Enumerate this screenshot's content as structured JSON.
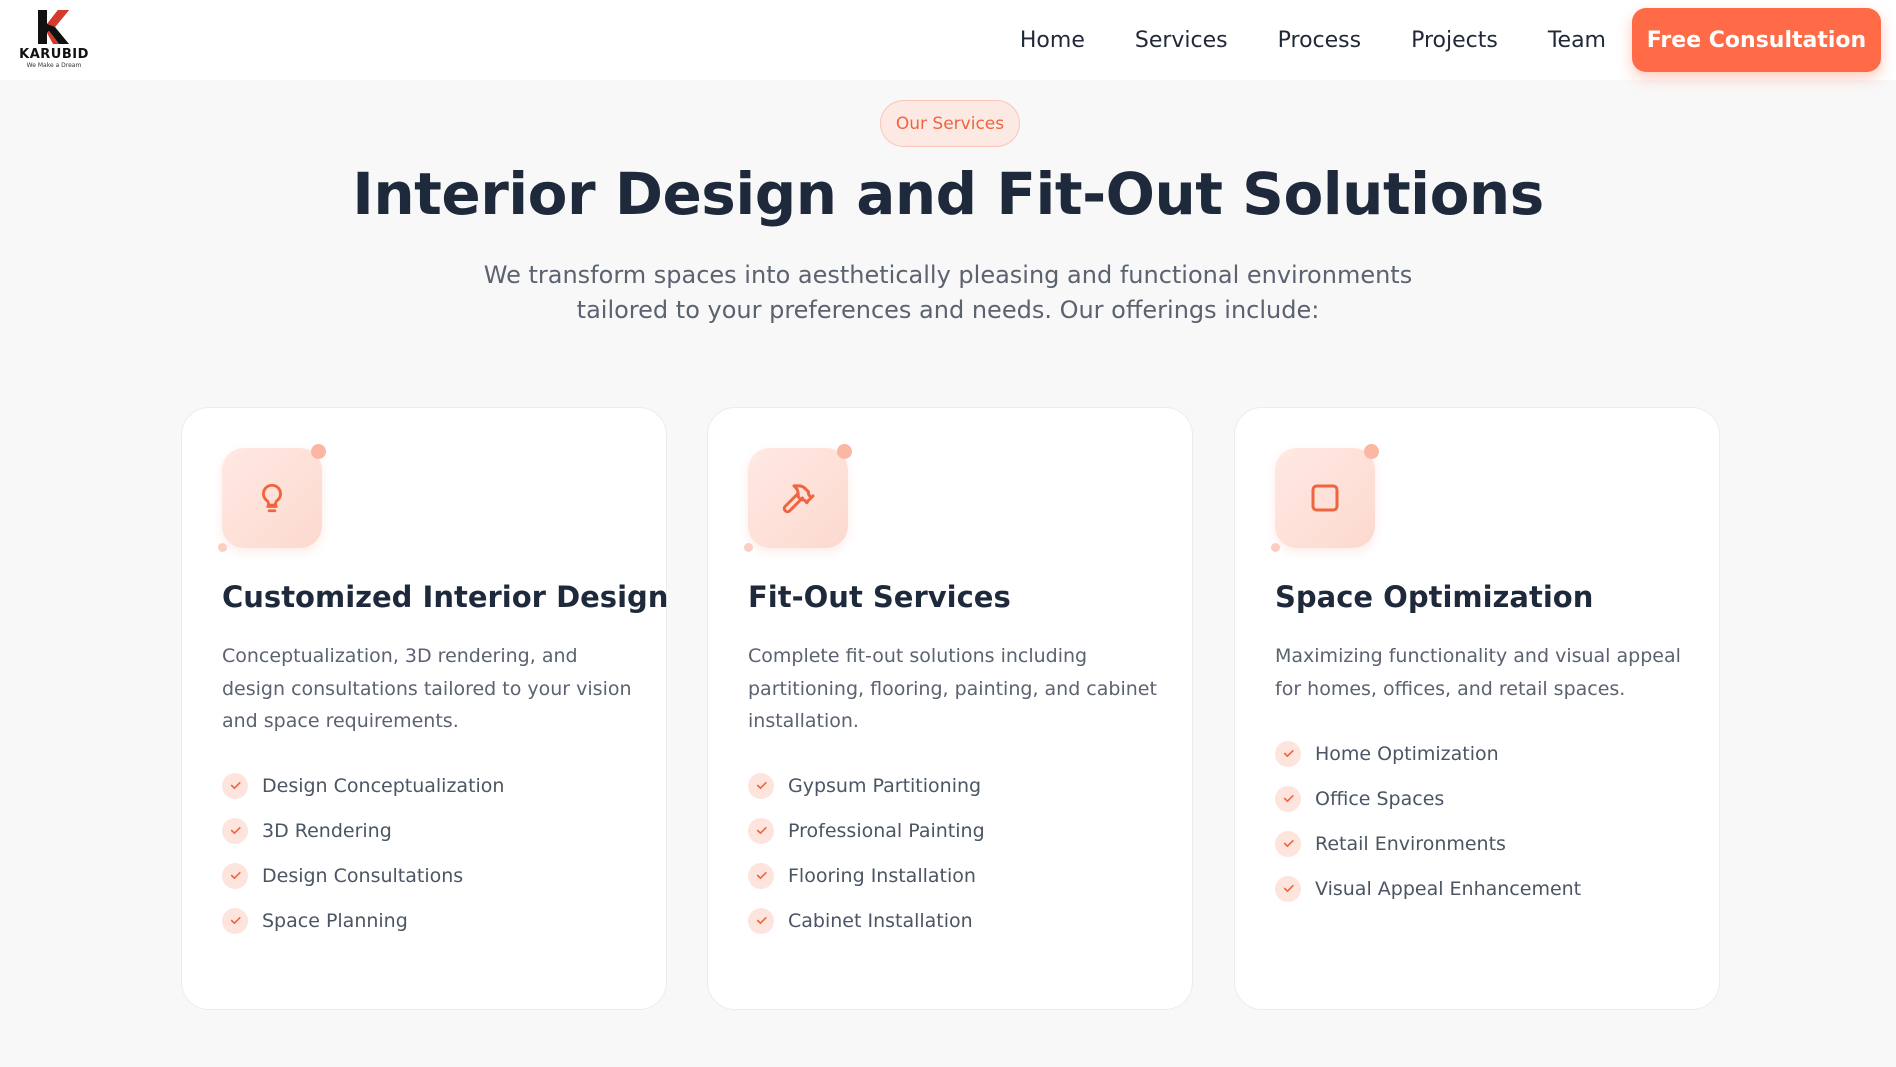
{
  "brand": {
    "name": "KARUBID",
    "tagline": "We Make a Dream",
    "accent": "#ff6b47"
  },
  "nav": {
    "items": [
      "Home",
      "Services",
      "Process",
      "Projects",
      "Team"
    ],
    "cta_label": "Free Consultation"
  },
  "hero": {
    "badge": "Our Services",
    "title": "Interior Design and Fit-Out Solutions",
    "subtitle": "We transform spaces into aesthetically pleasing and functional environments tailored to your preferences and needs. Our offerings include:"
  },
  "cards": [
    {
      "icon": "lightbulb-icon",
      "title": "Customized Interior Design",
      "description": "Conceptualization, 3D rendering, and design consultations tailored to your vision and space requirements.",
      "features": [
        "Design Conceptualization",
        "3D Rendering",
        "Design Consultations",
        "Space Planning"
      ]
    },
    {
      "icon": "hammer-icon",
      "title": "Fit-Out Services",
      "description": "Complete fit-out solutions including partitioning, flooring, painting, and cabinet installation.",
      "features": [
        "Gypsum Partitioning",
        "Professional Painting",
        "Flooring Installation",
        "Cabinet Installation"
      ]
    },
    {
      "icon": "square-icon",
      "title": "Space Optimization",
      "description": "Maximizing functionality and visual appeal for homes, offices, and retail spaces.",
      "features": [
        "Home Optimization",
        "Office Spaces",
        "Retail Environments",
        "Visual Appeal Enhancement"
      ]
    }
  ]
}
